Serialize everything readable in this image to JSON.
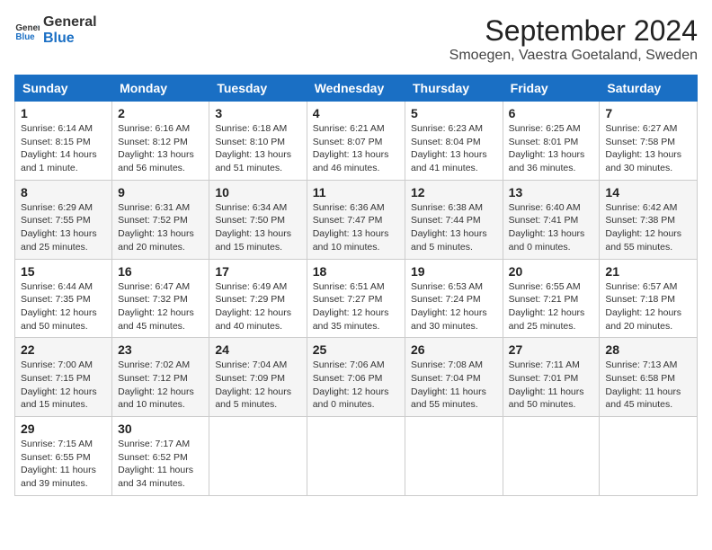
{
  "header": {
    "logo_line1": "General",
    "logo_line2": "Blue",
    "title": "September 2024",
    "subtitle": "Smoegen, Vaestra Goetaland, Sweden"
  },
  "weekdays": [
    "Sunday",
    "Monday",
    "Tuesday",
    "Wednesday",
    "Thursday",
    "Friday",
    "Saturday"
  ],
  "weeks": [
    [
      {
        "day": "1",
        "lines": [
          "Sunrise: 6:14 AM",
          "Sunset: 8:15 PM",
          "Daylight: 14 hours",
          "and 1 minute."
        ]
      },
      {
        "day": "2",
        "lines": [
          "Sunrise: 6:16 AM",
          "Sunset: 8:12 PM",
          "Daylight: 13 hours",
          "and 56 minutes."
        ]
      },
      {
        "day": "3",
        "lines": [
          "Sunrise: 6:18 AM",
          "Sunset: 8:10 PM",
          "Daylight: 13 hours",
          "and 51 minutes."
        ]
      },
      {
        "day": "4",
        "lines": [
          "Sunrise: 6:21 AM",
          "Sunset: 8:07 PM",
          "Daylight: 13 hours",
          "and 46 minutes."
        ]
      },
      {
        "day": "5",
        "lines": [
          "Sunrise: 6:23 AM",
          "Sunset: 8:04 PM",
          "Daylight: 13 hours",
          "and 41 minutes."
        ]
      },
      {
        "day": "6",
        "lines": [
          "Sunrise: 6:25 AM",
          "Sunset: 8:01 PM",
          "Daylight: 13 hours",
          "and 36 minutes."
        ]
      },
      {
        "day": "7",
        "lines": [
          "Sunrise: 6:27 AM",
          "Sunset: 7:58 PM",
          "Daylight: 13 hours",
          "and 30 minutes."
        ]
      }
    ],
    [
      {
        "day": "8",
        "lines": [
          "Sunrise: 6:29 AM",
          "Sunset: 7:55 PM",
          "Daylight: 13 hours",
          "and 25 minutes."
        ]
      },
      {
        "day": "9",
        "lines": [
          "Sunrise: 6:31 AM",
          "Sunset: 7:52 PM",
          "Daylight: 13 hours",
          "and 20 minutes."
        ]
      },
      {
        "day": "10",
        "lines": [
          "Sunrise: 6:34 AM",
          "Sunset: 7:50 PM",
          "Daylight: 13 hours",
          "and 15 minutes."
        ]
      },
      {
        "day": "11",
        "lines": [
          "Sunrise: 6:36 AM",
          "Sunset: 7:47 PM",
          "Daylight: 13 hours",
          "and 10 minutes."
        ]
      },
      {
        "day": "12",
        "lines": [
          "Sunrise: 6:38 AM",
          "Sunset: 7:44 PM",
          "Daylight: 13 hours",
          "and 5 minutes."
        ]
      },
      {
        "day": "13",
        "lines": [
          "Sunrise: 6:40 AM",
          "Sunset: 7:41 PM",
          "Daylight: 13 hours",
          "and 0 minutes."
        ]
      },
      {
        "day": "14",
        "lines": [
          "Sunrise: 6:42 AM",
          "Sunset: 7:38 PM",
          "Daylight: 12 hours",
          "and 55 minutes."
        ]
      }
    ],
    [
      {
        "day": "15",
        "lines": [
          "Sunrise: 6:44 AM",
          "Sunset: 7:35 PM",
          "Daylight: 12 hours",
          "and 50 minutes."
        ]
      },
      {
        "day": "16",
        "lines": [
          "Sunrise: 6:47 AM",
          "Sunset: 7:32 PM",
          "Daylight: 12 hours",
          "and 45 minutes."
        ]
      },
      {
        "day": "17",
        "lines": [
          "Sunrise: 6:49 AM",
          "Sunset: 7:29 PM",
          "Daylight: 12 hours",
          "and 40 minutes."
        ]
      },
      {
        "day": "18",
        "lines": [
          "Sunrise: 6:51 AM",
          "Sunset: 7:27 PM",
          "Daylight: 12 hours",
          "and 35 minutes."
        ]
      },
      {
        "day": "19",
        "lines": [
          "Sunrise: 6:53 AM",
          "Sunset: 7:24 PM",
          "Daylight: 12 hours",
          "and 30 minutes."
        ]
      },
      {
        "day": "20",
        "lines": [
          "Sunrise: 6:55 AM",
          "Sunset: 7:21 PM",
          "Daylight: 12 hours",
          "and 25 minutes."
        ]
      },
      {
        "day": "21",
        "lines": [
          "Sunrise: 6:57 AM",
          "Sunset: 7:18 PM",
          "Daylight: 12 hours",
          "and 20 minutes."
        ]
      }
    ],
    [
      {
        "day": "22",
        "lines": [
          "Sunrise: 7:00 AM",
          "Sunset: 7:15 PM",
          "Daylight: 12 hours",
          "and 15 minutes."
        ]
      },
      {
        "day": "23",
        "lines": [
          "Sunrise: 7:02 AM",
          "Sunset: 7:12 PM",
          "Daylight: 12 hours",
          "and 10 minutes."
        ]
      },
      {
        "day": "24",
        "lines": [
          "Sunrise: 7:04 AM",
          "Sunset: 7:09 PM",
          "Daylight: 12 hours",
          "and 5 minutes."
        ]
      },
      {
        "day": "25",
        "lines": [
          "Sunrise: 7:06 AM",
          "Sunset: 7:06 PM",
          "Daylight: 12 hours",
          "and 0 minutes."
        ]
      },
      {
        "day": "26",
        "lines": [
          "Sunrise: 7:08 AM",
          "Sunset: 7:04 PM",
          "Daylight: 11 hours",
          "and 55 minutes."
        ]
      },
      {
        "day": "27",
        "lines": [
          "Sunrise: 7:11 AM",
          "Sunset: 7:01 PM",
          "Daylight: 11 hours",
          "and 50 minutes."
        ]
      },
      {
        "day": "28",
        "lines": [
          "Sunrise: 7:13 AM",
          "Sunset: 6:58 PM",
          "Daylight: 11 hours",
          "and 45 minutes."
        ]
      }
    ],
    [
      {
        "day": "29",
        "lines": [
          "Sunrise: 7:15 AM",
          "Sunset: 6:55 PM",
          "Daylight: 11 hours",
          "and 39 minutes."
        ]
      },
      {
        "day": "30",
        "lines": [
          "Sunrise: 7:17 AM",
          "Sunset: 6:52 PM",
          "Daylight: 11 hours",
          "and 34 minutes."
        ]
      },
      {
        "day": "",
        "lines": []
      },
      {
        "day": "",
        "lines": []
      },
      {
        "day": "",
        "lines": []
      },
      {
        "day": "",
        "lines": []
      },
      {
        "day": "",
        "lines": []
      }
    ]
  ]
}
